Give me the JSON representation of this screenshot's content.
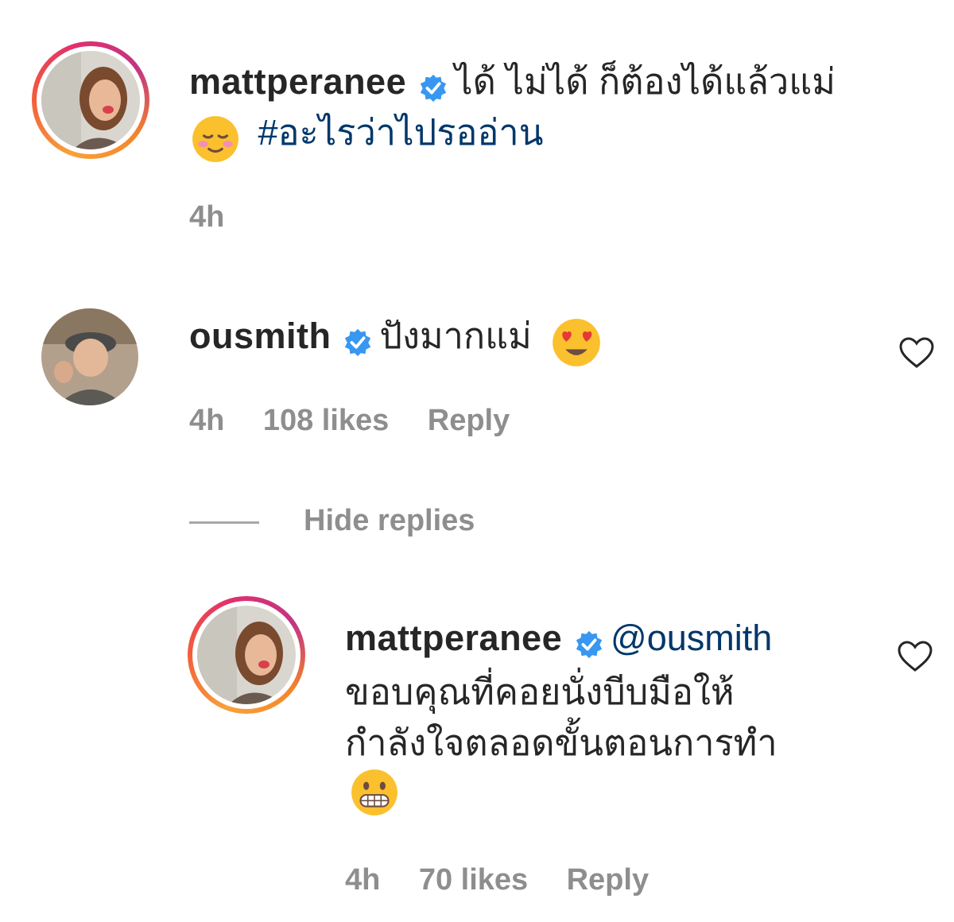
{
  "comments": [
    {
      "username": "mattperanee",
      "text_line1": "ได้ ไม่ได้ ก็ต้องได้แล้วแม่",
      "hashtag": "#อะไรว่าไปรออ่าน",
      "time": "4h",
      "emoji": "relieved-face-emoji"
    },
    {
      "username": "ousmith",
      "text": "ปังมากแม่",
      "time": "4h",
      "likes": "108 likes",
      "reply": "Reply",
      "emoji": "heart-eyes-emoji"
    }
  ],
  "hide_replies": "Hide replies",
  "reply": {
    "username": "mattperanee",
    "mention": "@ousmith",
    "text_line1": "ขอบคุณที่คอยนั่งบีบมือให้",
    "text_line2": "กำลังใจตลอดขั้นตอนการทำ",
    "time": "4h",
    "likes": "70 likes",
    "reply": "Reply",
    "emoji": "grimacing-face-emoji"
  },
  "colors": {
    "text": "#262626",
    "meta": "#8e8e8e",
    "link": "#00376b",
    "verified": "#3897f0"
  }
}
